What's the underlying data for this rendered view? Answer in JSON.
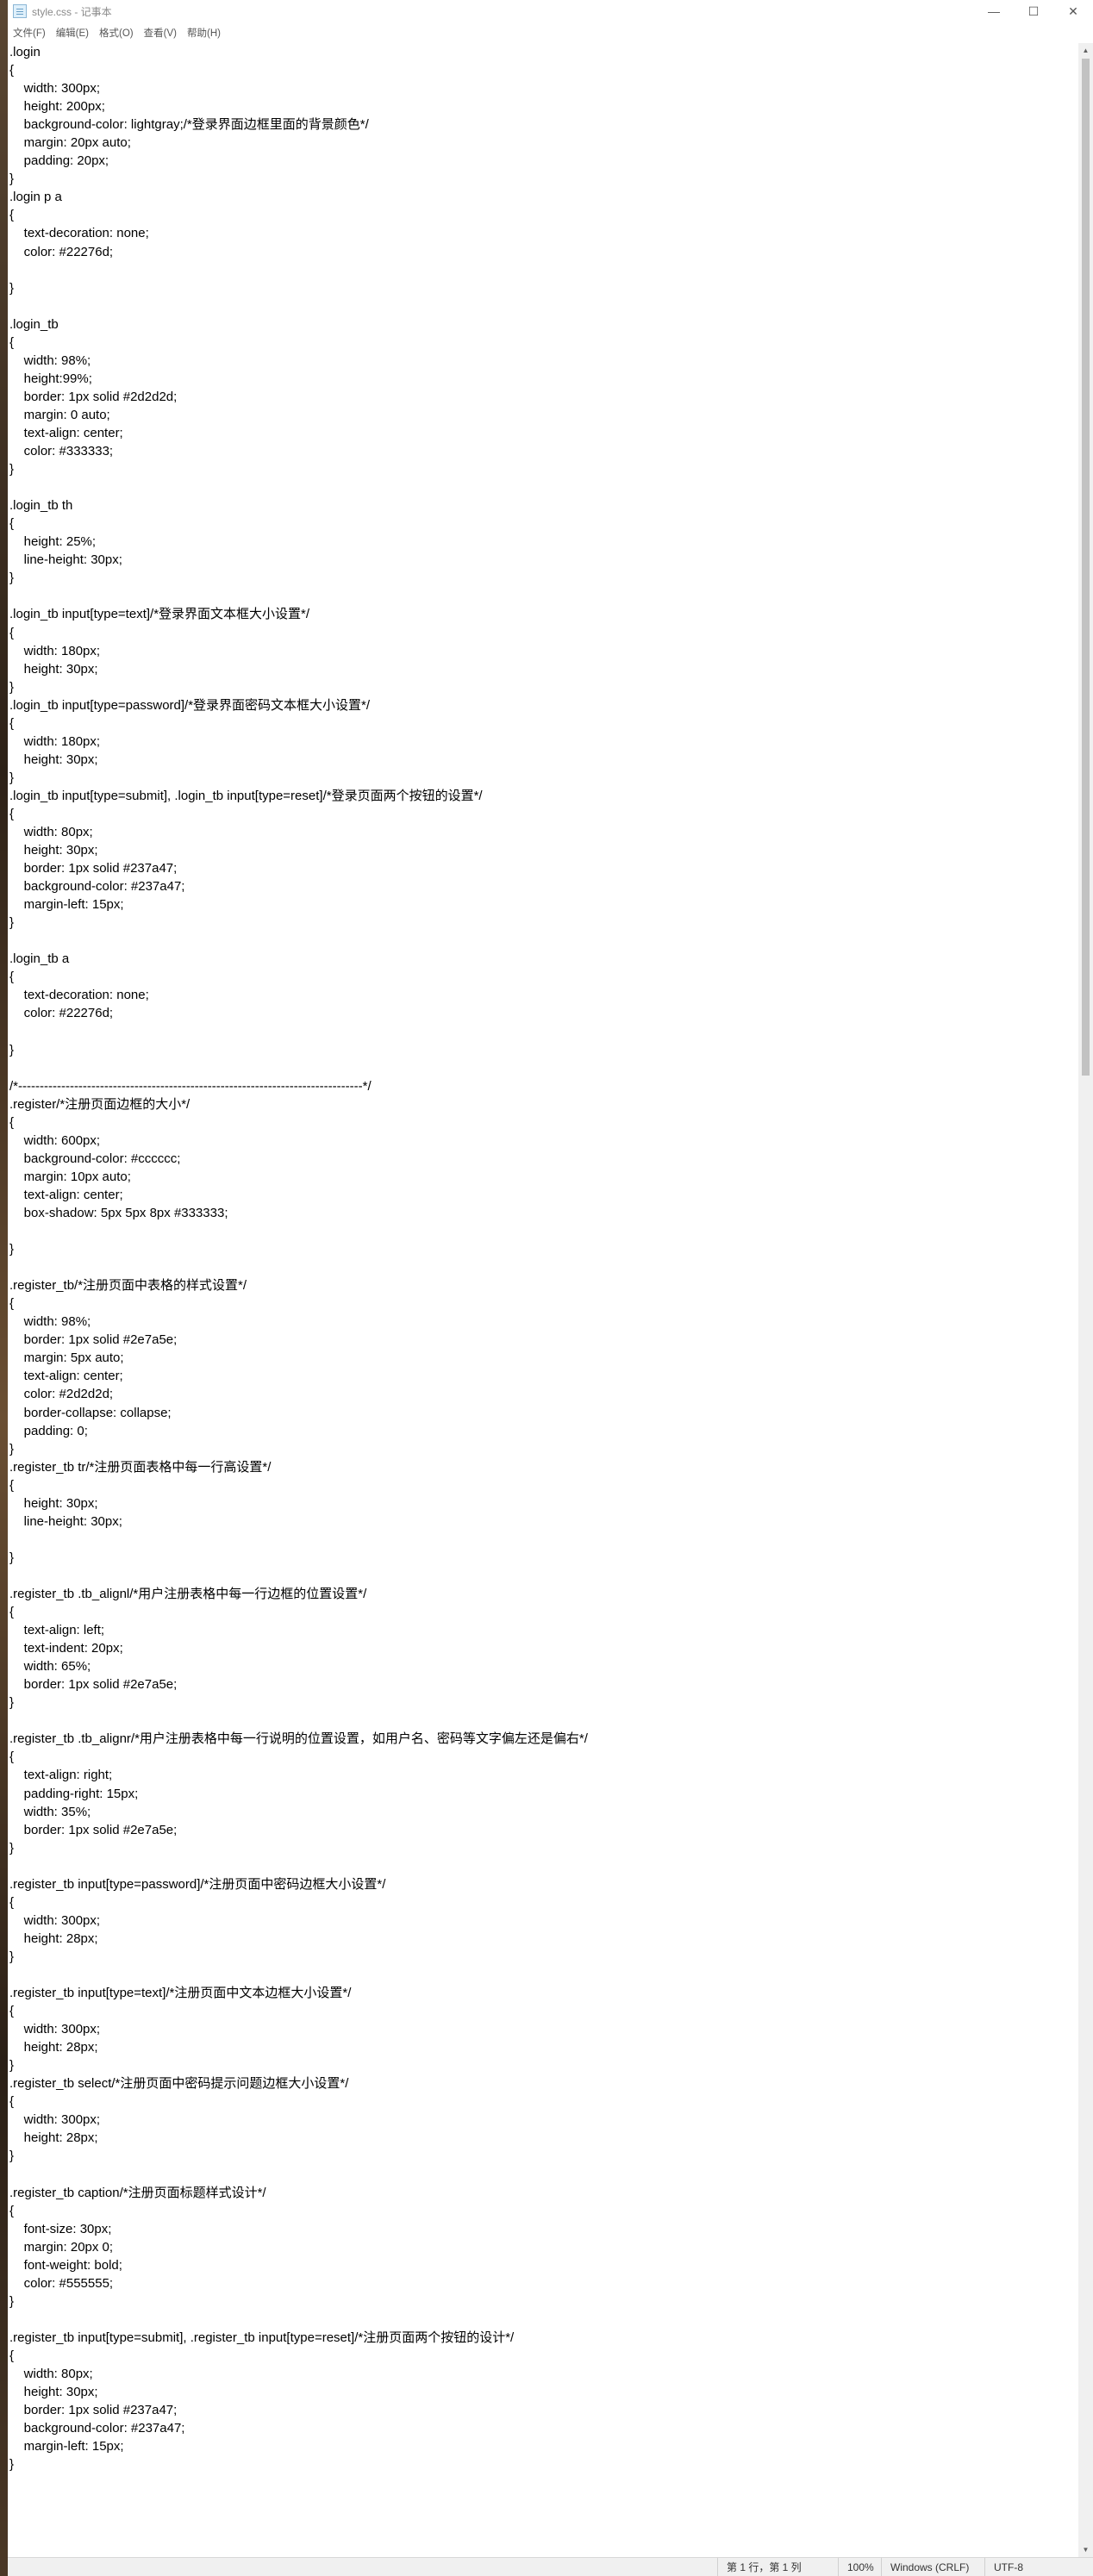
{
  "window": {
    "title": "style.css - 记事本",
    "controls": {
      "minimize": "—",
      "maximize": "☐",
      "close": "✕"
    }
  },
  "menu": {
    "items": [
      "文件(F)",
      "编辑(E)",
      "格式(O)",
      "查看(V)",
      "帮助(H)"
    ]
  },
  "editor": {
    "content": ".login\n{\n    width: 300px;\n    height: 200px;\n    background-color: lightgray;/*登录界面边框里面的背景颜色*/\n    margin: 20px auto;\n    padding: 20px;\n}\n.login p a\n{\n    text-decoration: none;\n    color: #22276d;\n\n}\n\n.login_tb\n{\n    width: 98%;\n    height:99%;\n    border: 1px solid #2d2d2d;\n    margin: 0 auto;\n    text-align: center;\n    color: #333333;\n}\n\n.login_tb th\n{\n    height: 25%;\n    line-height: 30px;\n}\n\n.login_tb input[type=text]/*登录界面文本框大小设置*/\n{\n    width: 180px;\n    height: 30px;\n}\n.login_tb input[type=password]/*登录界面密码文本框大小设置*/\n{\n    width: 180px;\n    height: 30px;\n}\n.login_tb input[type=submit], .login_tb input[type=reset]/*登录页面两个按钮的设置*/\n{\n    width: 80px;\n    height: 30px;\n    border: 1px solid #237a47;\n    background-color: #237a47;\n    margin-left: 15px;\n}\n\n.login_tb a\n{\n    text-decoration: none;\n    color: #22276d;\n\n}\n\n/*--------------------------------------------------------------------------------*/\n.register/*注册页面边框的大小*/\n{\n    width: 600px;\n    background-color: #cccccc;\n    margin: 10px auto;\n    text-align: center;\n    box-shadow: 5px 5px 8px #333333;\n\n}\n\n.register_tb/*注册页面中表格的样式设置*/\n{\n    width: 98%;\n    border: 1px solid #2e7a5e;\n    margin: 5px auto;\n    text-align: center;\n    color: #2d2d2d;\n    border-collapse: collapse;\n    padding: 0;\n}\n.register_tb tr/*注册页面表格中每一行高设置*/\n{\n    height: 30px;\n    line-height: 30px;\n\n}\n\n.register_tb .tb_alignl/*用户注册表格中每一行边框的位置设置*/\n{\n    text-align: left;\n    text-indent: 20px;\n    width: 65%;\n    border: 1px solid #2e7a5e;\n}\n\n.register_tb .tb_alignr/*用户注册表格中每一行说明的位置设置，如用户名、密码等文字偏左还是偏右*/\n{\n    text-align: right;\n    padding-right: 15px;\n    width: 35%;\n    border: 1px solid #2e7a5e;\n}\n\n.register_tb input[type=password]/*注册页面中密码边框大小设置*/\n{\n    width: 300px;\n    height: 28px;\n}\n\n.register_tb input[type=text]/*注册页面中文本边框大小设置*/\n{\n    width: 300px;\n    height: 28px;\n}\n.register_tb select/*注册页面中密码提示问题边框大小设置*/\n{\n    width: 300px;\n    height: 28px;\n}\n\n.register_tb caption/*注册页面标题样式设计*/\n{\n    font-size: 30px;\n    margin: 20px 0;\n    font-weight: bold;\n    color: #555555;\n}\n\n.register_tb input[type=submit], .register_tb input[type=reset]/*注册页面两个按钮的设计*/\n{\n    width: 80px;\n    height: 30px;\n    border: 1px solid #237a47;\n    background-color: #237a47;\n    margin-left: 15px;\n}"
  },
  "status": {
    "position": "第 1 行，第 1 列",
    "zoom": "100%",
    "line_ending": "Windows (CRLF)",
    "encoding": "UTF-8"
  }
}
